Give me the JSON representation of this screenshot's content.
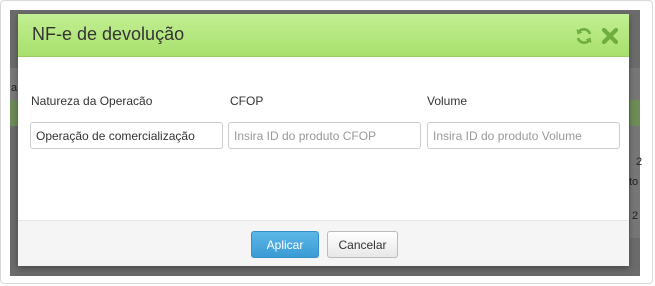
{
  "background": {
    "fragments": [
      "a",
      "2",
      "to",
      "2"
    ]
  },
  "modal": {
    "title": "NF-e de devolução",
    "icons": [
      "refresh-icon",
      "close-icon"
    ],
    "fields": {
      "natureza": {
        "label": "Natureza da Operacão",
        "value": "Operação de comercialização"
      },
      "cfop": {
        "label": "CFOP",
        "placeholder": "Insira ID do produto CFOP"
      },
      "volume": {
        "label": "Volume",
        "placeholder": "Insira ID do produto Volume"
      }
    },
    "footer": {
      "apply_label": "Aplicar",
      "cancel_label": "Cancelar"
    }
  },
  "colors": {
    "header_green": "#b6e882",
    "primary_button": "#4aa8de",
    "icon_green": "#6fae3e"
  }
}
